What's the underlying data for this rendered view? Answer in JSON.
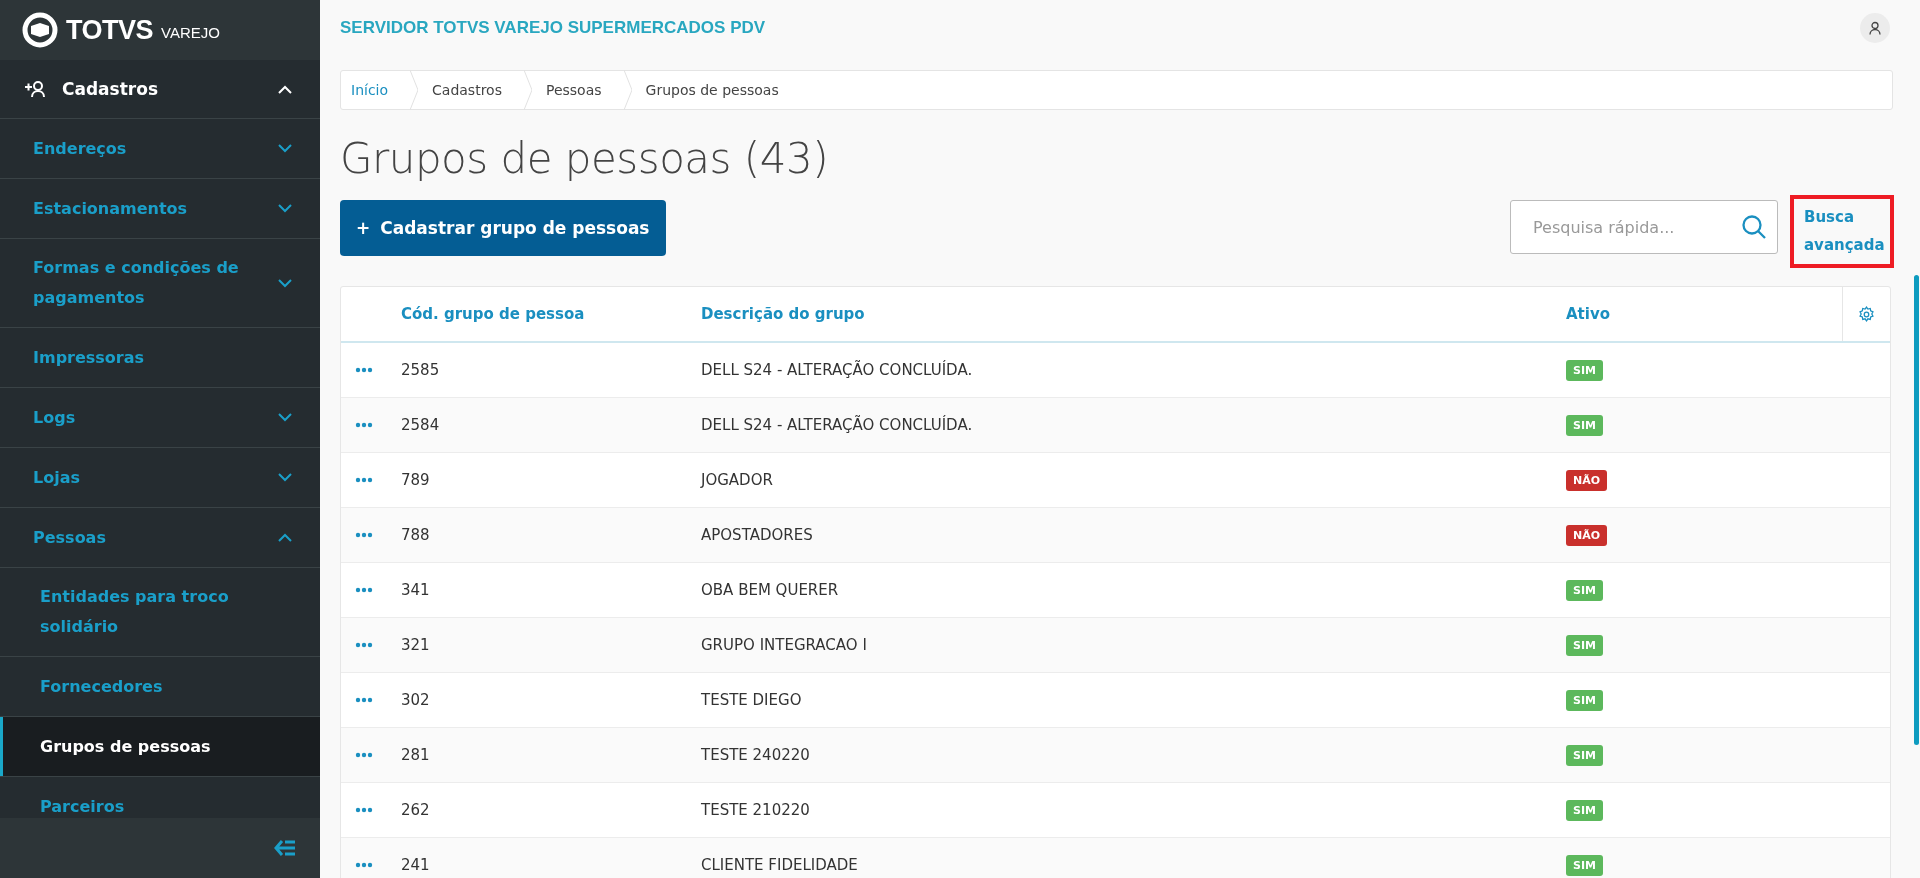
{
  "brand": {
    "name": "TOTVS",
    "product": "VAREJO"
  },
  "sidebar": {
    "section": {
      "label": "Cadastros",
      "expanded": true
    },
    "items": [
      {
        "label": "Endereços",
        "expanded": false
      },
      {
        "label": "Estacionamentos",
        "expanded": false
      },
      {
        "label": "Formas e condições de pagamentos",
        "expanded": false
      },
      {
        "label": "Impressoras"
      },
      {
        "label": "Logs",
        "expanded": false
      },
      {
        "label": "Lojas",
        "expanded": false
      },
      {
        "label": "Pessoas",
        "expanded": true,
        "children": [
          {
            "label": "Entidades para troco solidário",
            "selected": false
          },
          {
            "label": "Fornecedores",
            "selected": false
          },
          {
            "label": "Grupos de pessoas",
            "selected": true
          },
          {
            "label": "Parceiros",
            "selected": false
          }
        ]
      }
    ]
  },
  "header": {
    "title": "SERVIDOR TOTVS VAREJO SUPERMERCADOS PDV"
  },
  "breadcrumb": [
    {
      "label": "Início",
      "link": true
    },
    {
      "label": "Cadastros",
      "link": false
    },
    {
      "label": "Pessoas",
      "link": false
    },
    {
      "label": "Grupos de pessoas",
      "link": false
    }
  ],
  "page_title": "Grupos de pessoas (43)",
  "create_button": {
    "icon": "+",
    "label": "Cadastrar grupo de pessoas"
  },
  "search": {
    "placeholder": "Pesquisa rápida..."
  },
  "advanced_search": {
    "label": "Busca avançada",
    "highlighted": true
  },
  "table": {
    "columns": [
      "Cód. grupo de pessoa",
      "Descrição do grupo",
      "Ativo"
    ],
    "rows": [
      {
        "code": "2585",
        "description": "DELL S24 - ALTERAÇÃO CONCLUÍDA.",
        "active": true,
        "status": "SIM"
      },
      {
        "code": "2584",
        "description": "DELL S24 - ALTERAÇÃO CONCLUÍDA.",
        "active": true,
        "status": "SIM"
      },
      {
        "code": "789",
        "description": "JOGADOR",
        "active": false,
        "status": "NÃO"
      },
      {
        "code": "788",
        "description": "APOSTADORES",
        "active": false,
        "status": "NÃO"
      },
      {
        "code": "341",
        "description": "OBA BEM QUERER",
        "active": true,
        "status": "SIM"
      },
      {
        "code": "321",
        "description": "GRUPO INTEGRACAO I",
        "active": true,
        "status": "SIM"
      },
      {
        "code": "302",
        "description": "TESTE DIEGO",
        "active": true,
        "status": "SIM"
      },
      {
        "code": "281",
        "description": "TESTE 240220",
        "active": true,
        "status": "SIM"
      },
      {
        "code": "262",
        "description": "TESTE 210220",
        "active": true,
        "status": "SIM"
      },
      {
        "code": "241",
        "description": "CLIENTE FIDELIDADE",
        "active": true,
        "status": "SIM"
      }
    ]
  }
}
